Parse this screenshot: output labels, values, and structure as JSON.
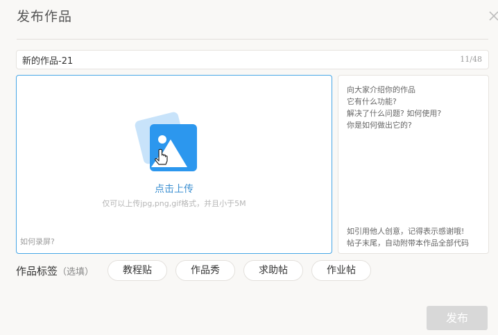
{
  "dialog": {
    "title": "发布作品",
    "close_icon": "close-icon"
  },
  "name_field": {
    "value": "新的作品-21",
    "counter": "11/48"
  },
  "upload": {
    "icon": "image-upload-icon",
    "cta": "点击上传",
    "hint": "仅可以上传jpg,png,gif格式，并且小于5M",
    "record_link": "如何录屏?"
  },
  "description": {
    "placeholder_lines": [
      "向大家介绍你的作品",
      "它有什么功能?",
      "解决了什么问题? 如何使用?",
      "你是如何做出它的?"
    ],
    "footer_lines": [
      "如引用他人创意，记得表示感谢哦!",
      "帖子末尾，自动附带本作品全部代码"
    ]
  },
  "tags": {
    "label": "作品标签",
    "optional": "（选填）",
    "items": [
      "教程贴",
      "作品秀",
      "求助帖",
      "作业帖"
    ]
  },
  "submit_label": "发布",
  "colors": {
    "accent": "#46a6e6",
    "accent_text": "#3b8fd1",
    "disabled_button": "#d8d8d8",
    "background": "#f9f8f6"
  }
}
